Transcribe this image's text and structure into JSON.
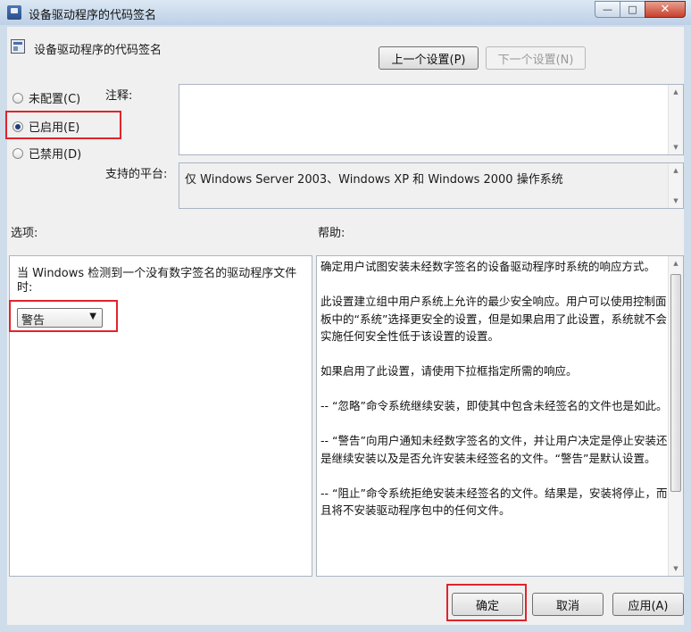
{
  "window": {
    "title": "设备驱动程序的代码签名",
    "caption": {
      "minimize": "—",
      "maximize": "□",
      "close": "✕"
    }
  },
  "header": {
    "title": "设备驱动程序的代码签名",
    "prev_label": "上一个设置(P)",
    "next_label": "下一个设置(N)"
  },
  "state": {
    "options": [
      {
        "label": "未配置(C)",
        "checked": false
      },
      {
        "label": "已启用(E)",
        "checked": true
      },
      {
        "label": "已禁用(D)",
        "checked": false
      }
    ]
  },
  "comment": {
    "label": "注释:",
    "value": ""
  },
  "platform": {
    "label": "支持的平台:",
    "value": "仅 Windows Server 2003、Windows XP 和 Windows 2000 操作系统"
  },
  "options_section": {
    "label": "选项:",
    "prompt": "当 Windows 检测到一个没有数字签名的驱动程序文件时:",
    "selected": "警告"
  },
  "help_section": {
    "label": "帮助:",
    "paragraphs": [
      "确定用户试图安装未经数字签名的设备驱动程序时系统的响应方式。",
      "此设置建立组中用户系统上允许的最少安全响应。用户可以使用控制面板中的“系统”选择更安全的设置，但是如果启用了此设置，系统就不会实施任何安全性低于该设置的设置。",
      "如果启用了此设置，请使用下拉框指定所需的响应。",
      "-- “忽略”命令系统继续安装，即使其中包含未经签名的文件也是如此。",
      "-- “警告”向用户通知未经数字签名的文件，并让用户决定是停止安装还是继续安装以及是否允许安装未经签名的文件。“警告”是默认设置。",
      "-- “阻止”命令系统拒绝安装未经签名的文件。结果是，安装将停止，而且将不安装驱动程序包中的任何文件。"
    ]
  },
  "footer": {
    "ok_label": "确定",
    "cancel_label": "取消",
    "apply_label": "应用(A)"
  },
  "colors": {
    "highlight": "#e0242b",
    "window_frame": "#cfdcea"
  }
}
